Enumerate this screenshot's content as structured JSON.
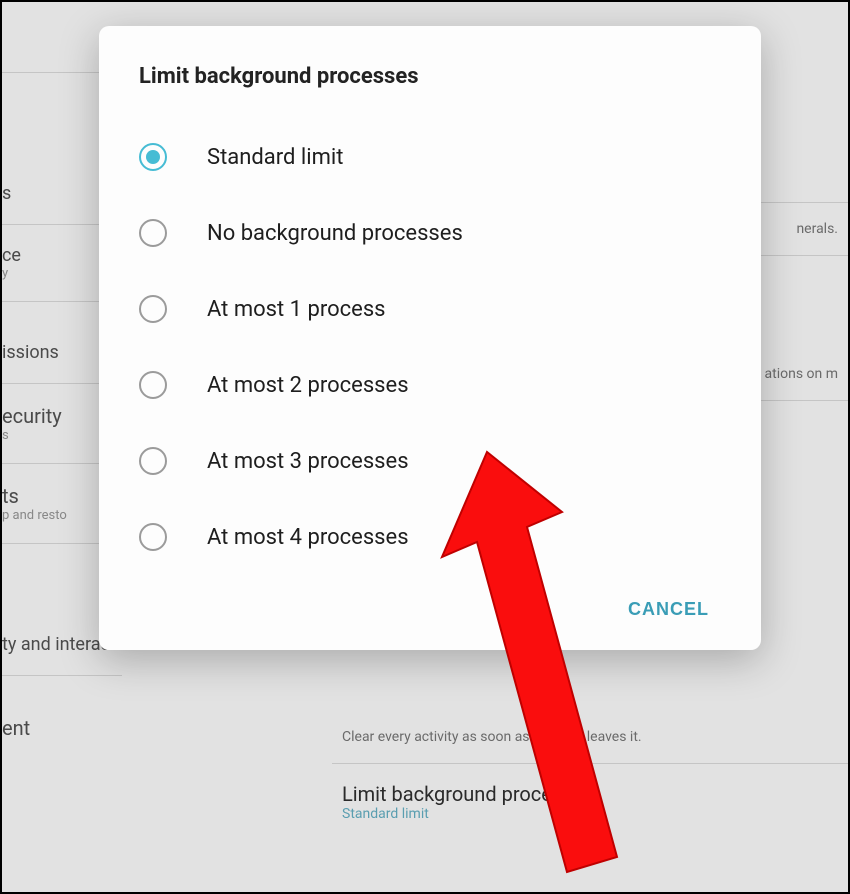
{
  "dialog": {
    "title": "Limit background processes",
    "options": [
      {
        "label": "Standard limit",
        "selected": true
      },
      {
        "label": "No background processes",
        "selected": false
      },
      {
        "label": "At most 1 process",
        "selected": false
      },
      {
        "label": "At most 2 processes",
        "selected": false
      },
      {
        "label": "At most 3 processes",
        "selected": false
      },
      {
        "label": "At most 4 processes",
        "selected": false
      }
    ],
    "cancel": "CANCEL"
  },
  "background": {
    "left_items": [
      {
        "title": "s",
        "sub": ""
      },
      {
        "title": "ce",
        "sub": "y"
      },
      {
        "title": "issions",
        "sub": ""
      },
      {
        "title": "ecurity",
        "sub": "s"
      },
      {
        "title": "ts",
        "sub": "p and resto"
      },
      {
        "title": "ty and interaction",
        "sub": ""
      },
      {
        "title": "ent",
        "sub": ""
      }
    ],
    "right_items": [
      {
        "desc": "nerals."
      },
      {
        "desc": "ations on m"
      },
      {
        "desc": "Clear every activity as soon as the user leaves it."
      },
      {
        "title": "Limit background processes",
        "sub": "Standard limit"
      }
    ]
  },
  "colors": {
    "accent": "#46bcd4",
    "cancel_text": "#3a9db6",
    "scrim": "#e2e2e2",
    "arrow": "#f00f0f"
  }
}
